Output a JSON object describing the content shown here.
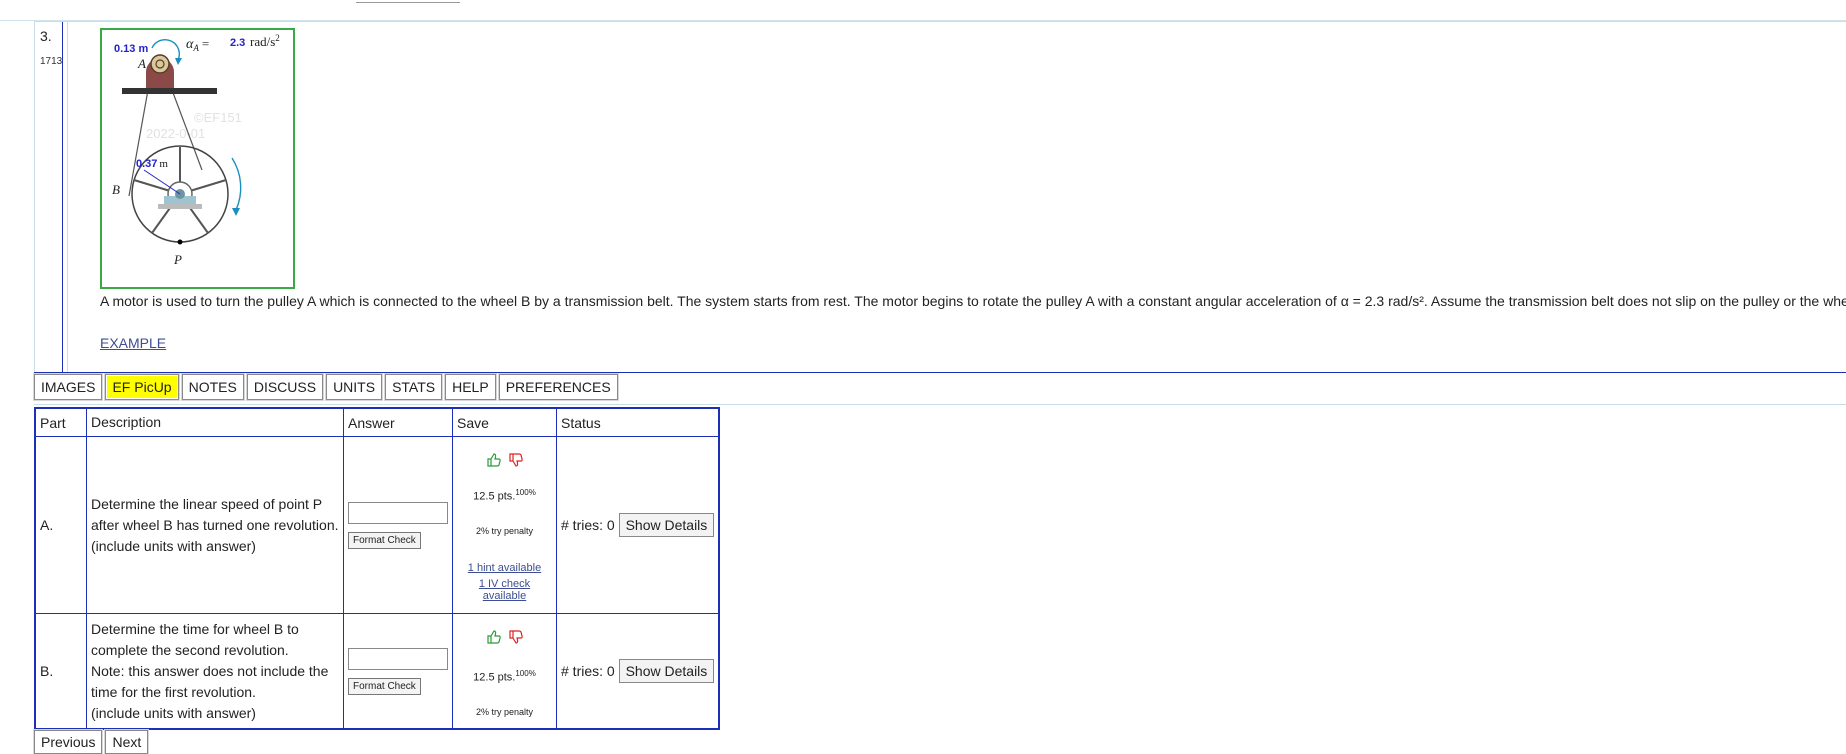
{
  "problem": {
    "number": "3.",
    "id": "1713",
    "figure": {
      "small_radius": "0.13 m",
      "alpha_label": "α",
      "alpha_sub": "A",
      "alpha_eq": "=",
      "alpha_value": "2.3",
      "alpha_unit": "rad/s",
      "alpha_exp": "2",
      "label_a": "A",
      "label_b": "B",
      "label_p": "P",
      "large_radius_value": "0.37",
      "large_radius_unit": "m",
      "watermark_1": "©EF151",
      "watermark_2": "2022-0-01"
    },
    "statement": "A motor is used to turn the pulley A which is connected to the wheel B by a transmission belt. The system starts from rest. The motor begins to rotate the pulley A with a constant angular acceleration of α = 2.3 rad/s². Assume the transmission belt does not slip on the pulley or the wheel.",
    "example_link": "EXAMPLE"
  },
  "tabs": [
    "IMAGES",
    "EF PicUp",
    "NOTES",
    "DISCUSS",
    "UNITS",
    "STATS",
    "HELP",
    "PREFERENCES"
  ],
  "table": {
    "headers": [
      "Part",
      "Description",
      "Answer",
      "Save",
      "Status"
    ],
    "rows": [
      {
        "part": "A.",
        "desc_1": "Determine the linear speed of point P",
        "desc_2": "after wheel B has turned one revolution.",
        "desc_3": "(include units with answer)",
        "format_check": "Format Check",
        "points": "12.5 pts.",
        "percent": "100%",
        "penalty": "2% try penalty",
        "hint": "1 hint available",
        "iv": "1 IV check available",
        "tries": "# tries: 0",
        "show_details": "Show Details"
      },
      {
        "part": "B.",
        "desc_1": "Determine the time for wheel B to",
        "desc_2": "complete the second revolution.",
        "desc_3": "Note: this answer does not include the",
        "desc_4": "time for the first revolution.",
        "desc_5": "(include units with answer)",
        "format_check": "Format Check",
        "points": "12.5 pts.",
        "percent": "100%",
        "penalty": "2% try penalty",
        "tries": "# tries: 0",
        "show_details": "Show Details"
      }
    ]
  },
  "nav": {
    "previous": "Previous",
    "next": "Next"
  },
  "colors": {
    "accent_blue": "#1c2fb5",
    "highlight": "#ffff00",
    "figure_border": "#3aa843",
    "value_blue": "#2222cc"
  }
}
